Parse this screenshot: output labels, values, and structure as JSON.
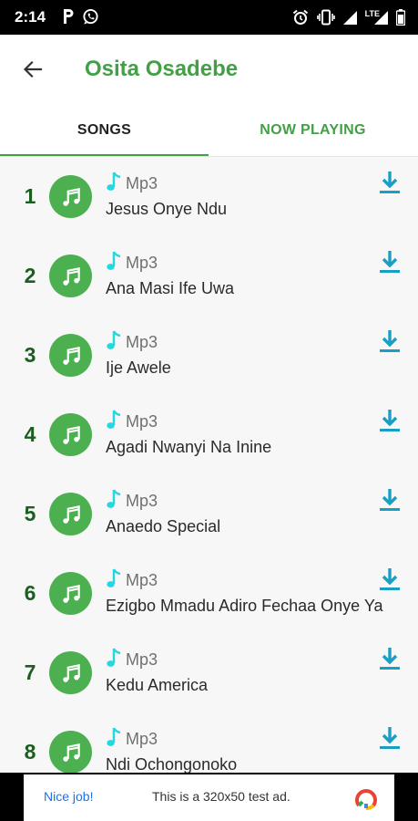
{
  "status_bar": {
    "time": "2:14",
    "left_icons": [
      "parking-icon",
      "whatsapp-icon"
    ],
    "right_icons": [
      "alarm-icon",
      "vibrate-icon",
      "signal-icon",
      "lte-signal-icon",
      "battery-icon"
    ],
    "network_label": "LTE"
  },
  "app_bar": {
    "title": "Osita Osadebe",
    "back_icon": "arrow-back-icon"
  },
  "tabs": [
    {
      "label": "SONGS",
      "selected": true
    },
    {
      "label": "NOW PLAYING",
      "selected": false
    }
  ],
  "songs": [
    {
      "number": "1",
      "type": "Mp3",
      "title": "Jesus Onye Ndu"
    },
    {
      "number": "2",
      "type": "Mp3",
      "title": "Ana Masi Ife Uwa"
    },
    {
      "number": "3",
      "type": "Mp3",
      "title": "Ije Awele"
    },
    {
      "number": "4",
      "type": "Mp3",
      "title": "Agadi Nwanyi Na Inine"
    },
    {
      "number": "5",
      "type": "Mp3",
      "title": "Anaedo Special"
    },
    {
      "number": "6",
      "type": "Mp3",
      "title": "Ezigbo Mmadu Adiro Fechaa Onye Ya"
    },
    {
      "number": "7",
      "type": "Mp3",
      "title": "Kedu America"
    },
    {
      "number": "8",
      "type": "Mp3",
      "title": "Ndi Ochongonoko"
    }
  ],
  "ad": {
    "nice_label": "Nice job!",
    "text": "This is a 320x50 test ad."
  },
  "colors": {
    "accent": "#43a047",
    "avatar": "#4caf50",
    "number": "#1b5e20",
    "note": "#26d7e0",
    "download": "#1a9fc4"
  }
}
